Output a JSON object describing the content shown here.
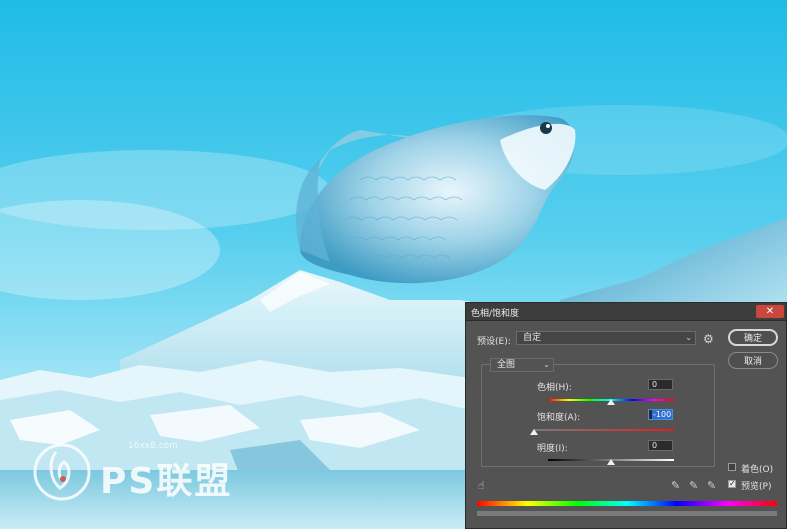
{
  "watermark": {
    "brand": "PS联盟",
    "site": "16xx8.com"
  },
  "dialog": {
    "title": "色相/饱和度",
    "close_icon": "close-icon",
    "preset_label": "预设(E):",
    "preset_value": "自定",
    "gear_icon": "gear-icon",
    "ok_label": "确定",
    "cancel_label": "取消",
    "channel_value": "全图",
    "hue": {
      "label": "色相(H):",
      "value": "0"
    },
    "saturation": {
      "label": "饱和度(A):",
      "value": "-100"
    },
    "lightness": {
      "label": "明度(I):",
      "value": "0"
    },
    "colorize": {
      "label": "着色(O)",
      "checked": false
    },
    "preview": {
      "label": "预览(P)",
      "checked": true
    },
    "check_mark": "✓",
    "icons": [
      "hand-adjust-icon",
      "eyedropper-icon",
      "eyedropper-plus-icon",
      "eyedropper-minus-icon"
    ]
  }
}
